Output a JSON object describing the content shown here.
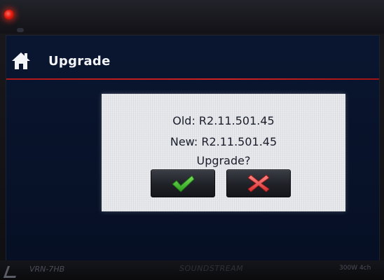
{
  "header": {
    "title": "Upgrade",
    "home_icon": "home-icon",
    "accent_color": "#c61c1c"
  },
  "dialog": {
    "old_version": "Old: R2.11.501.45",
    "new_version": "New: R2.11.501.45",
    "question": "Upgrade?",
    "confirm_icon": "checkmark-icon",
    "confirm_color": "#3fb52a",
    "cancel_icon": "cross-icon",
    "cancel_color": "#e24848"
  },
  "bezel": {
    "model": "VRN-7HB",
    "brand": "SOUNDSTREAM",
    "power": "300W 4ch",
    "led_color": "#ff2a14"
  }
}
